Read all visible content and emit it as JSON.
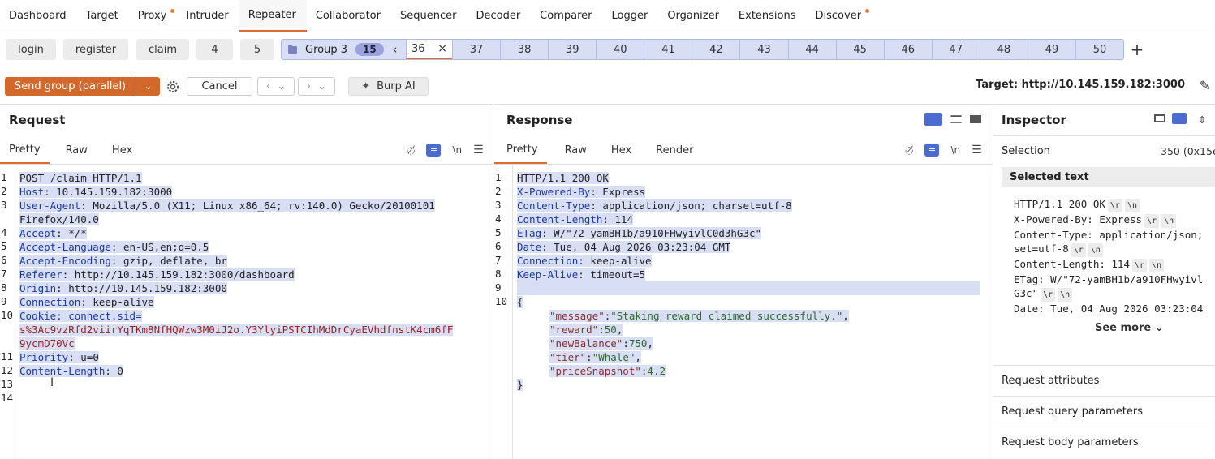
{
  "nav": {
    "tabs": [
      "Dashboard",
      "Target",
      "Proxy",
      "Intruder",
      "Repeater",
      "Collaborator",
      "Sequencer",
      "Decoder",
      "Comparer",
      "Logger",
      "Organizer",
      "Extensions",
      "Discover"
    ]
  },
  "repeater_tabs": {
    "loose": [
      "login",
      "register",
      "claim",
      "4",
      "5"
    ],
    "group": {
      "name": "Group 3",
      "count": "15",
      "prev": "‹",
      "active": "36",
      "close": "×",
      "numbers": [
        "37",
        "38",
        "39",
        "40",
        "41",
        "42",
        "43",
        "44",
        "45",
        "46",
        "47",
        "48",
        "49",
        "50"
      ]
    },
    "add": "+"
  },
  "actions": {
    "send": "Send group (parallel)",
    "send_dropdown": "⌄",
    "cancel": "Cancel",
    "burp_ai": "Burp AI",
    "target": "Target: http://10.145.159.182:3000"
  },
  "request": {
    "title": "Request",
    "tabs": [
      "Pretty",
      "Raw",
      "Hex"
    ],
    "newline": "\\n",
    "lines": [
      {
        "n": "1",
        "k": "POST /claim HTTP/1.1",
        "v": ""
      },
      {
        "n": "2",
        "k": "Host",
        "v": ": 10.145.159.182:3000"
      },
      {
        "n": "3",
        "k": "User-Agent",
        "v": ": Mozilla/5.0 (X11; Linux x86_64; rv:140.0) Gecko/20100101"
      },
      {
        "n": "",
        "k": "",
        "v": "Firefox/140.0"
      },
      {
        "n": "4",
        "k": "Accept",
        "v": ": */*"
      },
      {
        "n": "5",
        "k": "Accept-Language",
        "v": ": en-US,en;q=0.5"
      },
      {
        "n": "6",
        "k": "Accept-Encoding",
        "v": ": gzip, deflate, br"
      },
      {
        "n": "7",
        "k": "Referer",
        "v": ": http://10.145.159.182:3000/dashboard"
      },
      {
        "n": "8",
        "k": "Origin",
        "v": ": http://10.145.159.182:3000"
      },
      {
        "n": "9",
        "k": "Connection",
        "v": ": keep-alive"
      },
      {
        "n": "10",
        "k": "Cookie",
        "v": ": connect.sid="
      },
      {
        "n": "",
        "k": "",
        "v": "s%3Ac9vzRfd2viirYqTKm8NfHQWzw3M0iJ2o.Y3YlyiPSTCIhMdDrCyaEVhdfnstK4cm6fF"
      },
      {
        "n": "",
        "k": "",
        "v": "9ycmD70Vc"
      },
      {
        "n": "11",
        "k": "Priority",
        "v": ": u=0"
      },
      {
        "n": "12",
        "k": "Content-Length",
        "v": ": 0"
      },
      {
        "n": "13",
        "k": "",
        "v": ""
      },
      {
        "n": "14",
        "k": "",
        "v": ""
      }
    ]
  },
  "response": {
    "title": "Response",
    "tabs": [
      "Pretty",
      "Raw",
      "Hex",
      "Render"
    ],
    "newline": "\\n",
    "lines": [
      {
        "n": "1",
        "k": "HTTP/1.1 200 OK",
        "v": ""
      },
      {
        "n": "2",
        "k": "X-Powered-By",
        "v": ": Express"
      },
      {
        "n": "3",
        "k": "Content-Type",
        "v": ": application/json; charset=utf-8"
      },
      {
        "n": "4",
        "k": "Content-Length",
        "v": ": 114"
      },
      {
        "n": "5",
        "k": "ETag",
        "v": ": W/\"72-yamBH1b/a910FHwyivlC0d3hG3c\""
      },
      {
        "n": "6",
        "k": "Date",
        "v": ": Tue, 04 Aug 2026 03:23:04 GMT"
      },
      {
        "n": "7",
        "k": "Connection",
        "v": ": keep-alive"
      },
      {
        "n": "8",
        "k": "Keep-Alive",
        "v": ": timeout=5"
      },
      {
        "n": "9",
        "k": "",
        "v": ""
      },
      {
        "n": "10",
        "k": "",
        "v": "{"
      }
    ],
    "json": [
      {
        "key": "\"message\"",
        "val": "\"Staking reward claimed successfully.\"",
        "tail": ","
      },
      {
        "key": "\"reward\"",
        "val": "50",
        "tail": ","
      },
      {
        "key": "\"newBalance\"",
        "val": "750",
        "tail": ","
      },
      {
        "key": "\"tier\"",
        "val": "\"Whale\"",
        "tail": ","
      },
      {
        "key": "\"priceSnapshot\"",
        "val": "4.2",
        "tail": ""
      }
    ],
    "close": "}"
  },
  "inspector": {
    "title": "Inspector",
    "selection_label": "Selection",
    "selection_value": "350 (0x15e",
    "selected_text_label": "Selected text",
    "selected_lines": [
      {
        "text": "HTTP/1.1 200 OK",
        "esc": true
      },
      {
        "text": "X-Powered-By: Express",
        "esc": true
      },
      {
        "text": "Content-Type: application/json;",
        "esc": false
      },
      {
        "text": "set=utf-8",
        "esc": true
      },
      {
        "text": "Content-Length: 114",
        "esc": true
      },
      {
        "text": "ETag: W/\"72-yamBH1b/a910FHwyivl",
        "esc": false
      },
      {
        "text": "G3c\"",
        "esc": true
      },
      {
        "text": "Date: Tue, 04 Aug 2026 03:23:04",
        "esc": false
      }
    ],
    "esc_r": "\\r",
    "esc_n": "\\n",
    "see_more": "See more",
    "sections": [
      "Request attributes",
      "Request query parameters",
      "Request body parameters"
    ]
  },
  "colors": {
    "accent": "#e06b2a",
    "send": "#d2692a",
    "selection": "#d8def3"
  }
}
